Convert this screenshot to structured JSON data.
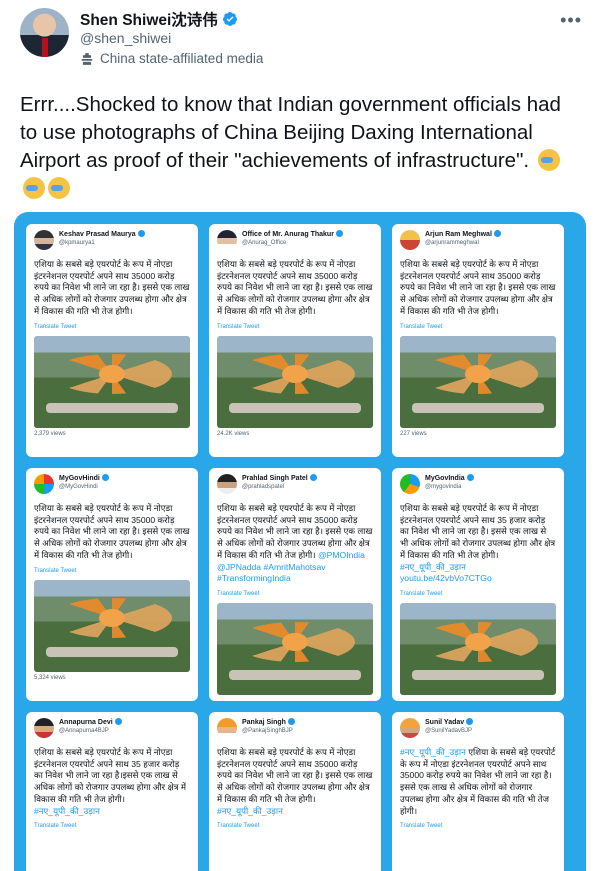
{
  "author": {
    "display_name": "Shen Shiwei沈诗伟",
    "handle": "@shen_shiwei",
    "affiliation": "China state-affiliated media",
    "verified_color": "#1d9bf0"
  },
  "tweet": {
    "text": "Errr....Shocked to know that Indian government officials had to use photographs of China Beijing Daxing International Airport as proof of their \"achievements of infrastructure\".",
    "emoji_count": 3
  },
  "media": {
    "background_color": "#29a7e9",
    "translate_label": "Translate Tweet",
    "cards": [
      {
        "name": "Keshav Prasad Maurya",
        "handle": "@kpmaurya1",
        "text": "एशिया के सबसे बड़े एयरपोर्ट के रूप में नोएडा इंटरनेशनल एयरपोर्ट अपने साथ 35000 करोड़ रुपये का निवेश भी लाने जा रहा है। इससे एक लाख से अधिक लोगों को रोजगार उपलब्ध होगा और क्षेत्र में विकास की गति भी तेज होगी।",
        "link_text": "",
        "views": "2,379 views"
      },
      {
        "name": "Office of Mr. Anurag Thakur",
        "handle": "@Anurag_Office",
        "text": "एशिया के सबसे बड़े एयरपोर्ट के रूप में नोएडा इंटरनेशनल एयरपोर्ट अपने साथ 35000 करोड़ रुपये का निवेश भी लाने जा रहा है। इससे एक लाख से अधिक लोगों को रोजगार उपलब्ध होगा और क्षेत्र में विकास की गति भी तेज होगी।",
        "link_text": "",
        "views": "24.2K views"
      },
      {
        "name": "Arjun Ram Meghwal",
        "handle": "@arjunrammeghwal",
        "text": "एशिया के सबसे बड़े एयरपोर्ट के रूप में नोएडा इंटरनेशनल एयरपोर्ट अपने साथ 35000 करोड़ रुपये का निवेश भी लाने जा रहा है। इससे एक लाख से अधिक लोगों को रोजगार उपलब्ध होगा और क्षेत्र में विकास की गति भी तेज होगी।",
        "link_text": "",
        "views": "227 views"
      },
      {
        "name": "MyGovHindi",
        "handle": "@MyGovHindi",
        "text": "एशिया के सबसे बड़े एयरपोर्ट के रूप में नोएडा इंटरनेशनल एयरपोर्ट अपने साथ 35000 करोड़ रुपये का निवेश भी लाने जा रहा है। इससे एक लाख से अधिक लोगों को रोजगार उपलब्ध होगा और क्षेत्र में विकास की गति भी तेज होगी।",
        "link_text": "",
        "views": "5,324 views"
      },
      {
        "name": "Prahlad Singh Patel",
        "handle": "@prahladspatel",
        "text": "एशिया के सबसे बड़े एयरपोर्ट के रूप में नोएडा इंटरनेशनल एयरपोर्ट अपने साथ 35000 करोड़ रुपये का निवेश भी लाने जा रहा है। इससे एक लाख से अधिक लोगों को रोजगार उपलब्ध होगा और क्षेत्र में विकास की गति भी तेज होगी।",
        "link_text": "@PMOIndia @JPNadda #AmritMahotsav #TransformingIndia",
        "views": ""
      },
      {
        "name": "MyGovIndia",
        "handle": "@mygovindia",
        "text": "एशिया के सबसे बड़े एयरपोर्ट के रूप में नोएडा इंटरनेशनल एयरपोर्ट अपने साथ 35 हजार करोड़ का निवेश भी लाने जा रहा है। इससे एक लाख से भी अधिक लोगों को रोजगार उपलब्ध होगा और क्षेत्र में विकास की गति भी तेज होगी।",
        "link_text": "#नए_यूपी_की_उड़ान youtu.be/42vbVo7CTGo",
        "views": ""
      },
      {
        "name": "Annapurna Devi",
        "handle": "@Annapurna4BJP",
        "text": "एशिया के सबसे बड़े एयरपोर्ट के रूप में नोएडा इंटरनेशनल एयरपोर्ट अपने साथ 35 हजार करोड़ का निवेश भी लाने जा रहा है।इससे एक लाख से अधिक लोगों को रोजगार उपलब्ध होगा और क्षेत्र में विकास की गति भी तेज होगी।",
        "link_text": "#नए_यूपी_की_उड़ान",
        "views": ""
      },
      {
        "name": "Pankaj Singh",
        "handle": "@PankajSinghBJP",
        "text": "एशिया के सबसे बड़े एयरपोर्ट के रूप में नोएडा इंटरनेशनल एयरपोर्ट अपने साथ 35000 करोड़ रुपये का निवेश भी लाने जा रहा है। इससे एक लाख से अधिक लोगों को रोजगार उपलब्ध होगा और क्षेत्र में विकास की गति भी तेज होगी।",
        "link_text": "#नए_यूपी_की_उड़ान",
        "views": ""
      },
      {
        "name": "Sunil Yadav",
        "handle": "@SunilYadavBJP",
        "text": "एशिया के सबसे बड़े एयरपोर्ट के रूप में नोएडा इंटरनेशनल एयरपोर्ट अपने साथ 35000 करोड़ रुपये का निवेश भी लाने जा रहा है। इससे एक लाख से अधिक लोगों को रोजगार उपलब्ध होगा और क्षेत्र में विकास की गति भी तेज होगी।",
        "link_text": "#नए_यूपी_की_उड़ान",
        "views": ""
      }
    ]
  }
}
